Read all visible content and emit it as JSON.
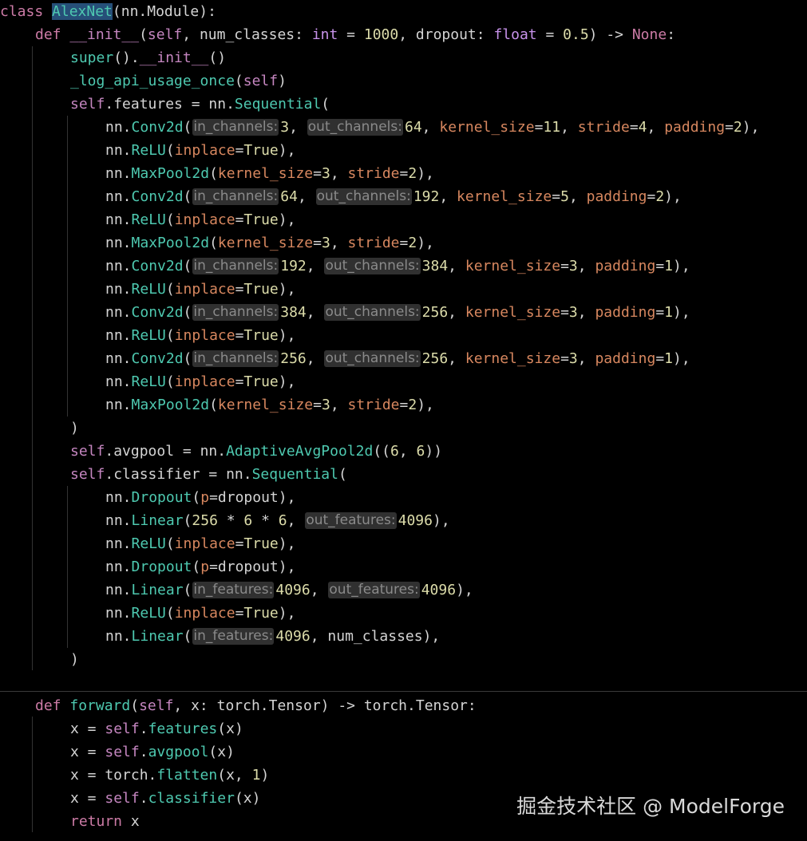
{
  "colors": {
    "background": "#000000",
    "default": "#d4d4d4",
    "keyword": "#cc7ba6",
    "function": "#4ec9b0",
    "self": "#c586c0",
    "number": "#dcdcaa",
    "param": "#d7875f",
    "dunder": "#c586c0",
    "class_name": "#4ec9b0",
    "type": "#c792ea",
    "hint_bg": "#303030",
    "hint_fg": "#8a8a8a",
    "watermark": "#d9d9d9"
  },
  "code_lines": [
    {
      "indent": 0,
      "tokens": [
        {
          "t": "class",
          "c": "keyword"
        },
        {
          "t": " "
        },
        {
          "t": "AlexNet",
          "c": "class_name",
          "cls": "cursor-hl"
        },
        {
          "t": "(nn.Module):"
        }
      ]
    },
    {
      "indent": 1,
      "tokens": [
        {
          "t": "def",
          "c": "keyword"
        },
        {
          "t": " "
        },
        {
          "t": "__init__",
          "c": "dunder"
        },
        {
          "t": "("
        },
        {
          "t": "self",
          "c": "self"
        },
        {
          "t": ", num_classes: "
        },
        {
          "t": "int",
          "c": "type"
        },
        {
          "t": " = "
        },
        {
          "t": "1000",
          "c": "number"
        },
        {
          "t": ", dropout: "
        },
        {
          "t": "float",
          "c": "type"
        },
        {
          "t": " = "
        },
        {
          "t": "0.5",
          "c": "number"
        },
        {
          "t": ") -> "
        },
        {
          "t": "None",
          "c": "keyword"
        },
        {
          "t": ":"
        }
      ]
    },
    {
      "indent": 2,
      "tokens": [
        {
          "t": "super",
          "c": "function"
        },
        {
          "t": "()."
        },
        {
          "t": "__init__",
          "c": "dunder"
        },
        {
          "t": "()"
        }
      ]
    },
    {
      "indent": 2,
      "tokens": [
        {
          "t": "_log_api_usage_once",
          "c": "function"
        },
        {
          "t": "("
        },
        {
          "t": "self",
          "c": "self"
        },
        {
          "t": ")"
        }
      ]
    },
    {
      "indent": 2,
      "tokens": [
        {
          "t": "self",
          "c": "self"
        },
        {
          "t": ".features = nn."
        },
        {
          "t": "Sequential",
          "c": "function"
        },
        {
          "t": "("
        }
      ]
    },
    {
      "indent": 3,
      "tokens": [
        {
          "t": "nn."
        },
        {
          "t": "Conv2d",
          "c": "function"
        },
        {
          "t": "("
        },
        {
          "hint": "in_channels:"
        },
        {
          "t": "3",
          "c": "number"
        },
        {
          "t": ", "
        },
        {
          "hint": "out_channels:"
        },
        {
          "t": "64",
          "c": "number"
        },
        {
          "t": ", "
        },
        {
          "t": "kernel_size",
          "c": "param"
        },
        {
          "t": "="
        },
        {
          "t": "11",
          "c": "number"
        },
        {
          "t": ", "
        },
        {
          "t": "stride",
          "c": "param"
        },
        {
          "t": "="
        },
        {
          "t": "4",
          "c": "number"
        },
        {
          "t": ", "
        },
        {
          "t": "padding",
          "c": "param"
        },
        {
          "t": "="
        },
        {
          "t": "2",
          "c": "number"
        },
        {
          "t": "),"
        }
      ]
    },
    {
      "indent": 3,
      "tokens": [
        {
          "t": "nn."
        },
        {
          "t": "ReLU",
          "c": "function"
        },
        {
          "t": "("
        },
        {
          "t": "inplace",
          "c": "param"
        },
        {
          "t": "="
        },
        {
          "t": "True",
          "c": "number"
        },
        {
          "t": "),"
        }
      ]
    },
    {
      "indent": 3,
      "tokens": [
        {
          "t": "nn."
        },
        {
          "t": "MaxPool2d",
          "c": "function"
        },
        {
          "t": "("
        },
        {
          "t": "kernel_size",
          "c": "param"
        },
        {
          "t": "="
        },
        {
          "t": "3",
          "c": "number"
        },
        {
          "t": ", "
        },
        {
          "t": "stride",
          "c": "param"
        },
        {
          "t": "="
        },
        {
          "t": "2",
          "c": "number"
        },
        {
          "t": "),"
        }
      ]
    },
    {
      "indent": 3,
      "tokens": [
        {
          "t": "nn."
        },
        {
          "t": "Conv2d",
          "c": "function"
        },
        {
          "t": "("
        },
        {
          "hint": "in_channels:"
        },
        {
          "t": "64",
          "c": "number"
        },
        {
          "t": ", "
        },
        {
          "hint": "out_channels:"
        },
        {
          "t": "192",
          "c": "number"
        },
        {
          "t": ", "
        },
        {
          "t": "kernel_size",
          "c": "param"
        },
        {
          "t": "="
        },
        {
          "t": "5",
          "c": "number"
        },
        {
          "t": ", "
        },
        {
          "t": "padding",
          "c": "param"
        },
        {
          "t": "="
        },
        {
          "t": "2",
          "c": "number"
        },
        {
          "t": "),"
        }
      ]
    },
    {
      "indent": 3,
      "tokens": [
        {
          "t": "nn."
        },
        {
          "t": "ReLU",
          "c": "function"
        },
        {
          "t": "("
        },
        {
          "t": "inplace",
          "c": "param"
        },
        {
          "t": "="
        },
        {
          "t": "True",
          "c": "number"
        },
        {
          "t": "),"
        }
      ]
    },
    {
      "indent": 3,
      "tokens": [
        {
          "t": "nn."
        },
        {
          "t": "MaxPool2d",
          "c": "function"
        },
        {
          "t": "("
        },
        {
          "t": "kernel_size",
          "c": "param"
        },
        {
          "t": "="
        },
        {
          "t": "3",
          "c": "number"
        },
        {
          "t": ", "
        },
        {
          "t": "stride",
          "c": "param"
        },
        {
          "t": "="
        },
        {
          "t": "2",
          "c": "number"
        },
        {
          "t": "),"
        }
      ]
    },
    {
      "indent": 3,
      "tokens": [
        {
          "t": "nn."
        },
        {
          "t": "Conv2d",
          "c": "function"
        },
        {
          "t": "("
        },
        {
          "hint": "in_channels:"
        },
        {
          "t": "192",
          "c": "number"
        },
        {
          "t": ", "
        },
        {
          "hint": "out_channels:"
        },
        {
          "t": "384",
          "c": "number"
        },
        {
          "t": ", "
        },
        {
          "t": "kernel_size",
          "c": "param"
        },
        {
          "t": "="
        },
        {
          "t": "3",
          "c": "number"
        },
        {
          "t": ", "
        },
        {
          "t": "padding",
          "c": "param"
        },
        {
          "t": "="
        },
        {
          "t": "1",
          "c": "number"
        },
        {
          "t": "),"
        }
      ]
    },
    {
      "indent": 3,
      "tokens": [
        {
          "t": "nn."
        },
        {
          "t": "ReLU",
          "c": "function"
        },
        {
          "t": "("
        },
        {
          "t": "inplace",
          "c": "param"
        },
        {
          "t": "="
        },
        {
          "t": "True",
          "c": "number"
        },
        {
          "t": "),"
        }
      ]
    },
    {
      "indent": 3,
      "tokens": [
        {
          "t": "nn."
        },
        {
          "t": "Conv2d",
          "c": "function"
        },
        {
          "t": "("
        },
        {
          "hint": "in_channels:"
        },
        {
          "t": "384",
          "c": "number"
        },
        {
          "t": ", "
        },
        {
          "hint": "out_channels:"
        },
        {
          "t": "256",
          "c": "number"
        },
        {
          "t": ", "
        },
        {
          "t": "kernel_size",
          "c": "param"
        },
        {
          "t": "="
        },
        {
          "t": "3",
          "c": "number"
        },
        {
          "t": ", "
        },
        {
          "t": "padding",
          "c": "param"
        },
        {
          "t": "="
        },
        {
          "t": "1",
          "c": "number"
        },
        {
          "t": "),"
        }
      ]
    },
    {
      "indent": 3,
      "tokens": [
        {
          "t": "nn."
        },
        {
          "t": "ReLU",
          "c": "function"
        },
        {
          "t": "("
        },
        {
          "t": "inplace",
          "c": "param"
        },
        {
          "t": "="
        },
        {
          "t": "True",
          "c": "number"
        },
        {
          "t": "),"
        }
      ]
    },
    {
      "indent": 3,
      "tokens": [
        {
          "t": "nn."
        },
        {
          "t": "Conv2d",
          "c": "function"
        },
        {
          "t": "("
        },
        {
          "hint": "in_channels:"
        },
        {
          "t": "256",
          "c": "number"
        },
        {
          "t": ", "
        },
        {
          "hint": "out_channels:"
        },
        {
          "t": "256",
          "c": "number"
        },
        {
          "t": ", "
        },
        {
          "t": "kernel_size",
          "c": "param"
        },
        {
          "t": "="
        },
        {
          "t": "3",
          "c": "number"
        },
        {
          "t": ", "
        },
        {
          "t": "padding",
          "c": "param"
        },
        {
          "t": "="
        },
        {
          "t": "1",
          "c": "number"
        },
        {
          "t": "),"
        }
      ]
    },
    {
      "indent": 3,
      "tokens": [
        {
          "t": "nn."
        },
        {
          "t": "ReLU",
          "c": "function"
        },
        {
          "t": "("
        },
        {
          "t": "inplace",
          "c": "param"
        },
        {
          "t": "="
        },
        {
          "t": "True",
          "c": "number"
        },
        {
          "t": "),"
        }
      ]
    },
    {
      "indent": 3,
      "tokens": [
        {
          "t": "nn."
        },
        {
          "t": "MaxPool2d",
          "c": "function"
        },
        {
          "t": "("
        },
        {
          "t": "kernel_size",
          "c": "param"
        },
        {
          "t": "="
        },
        {
          "t": "3",
          "c": "number"
        },
        {
          "t": ", "
        },
        {
          "t": "stride",
          "c": "param"
        },
        {
          "t": "="
        },
        {
          "t": "2",
          "c": "number"
        },
        {
          "t": "),"
        }
      ]
    },
    {
      "indent": 2,
      "tokens": [
        {
          "t": ")"
        }
      ]
    },
    {
      "indent": 2,
      "tokens": [
        {
          "t": "self",
          "c": "self"
        },
        {
          "t": ".avgpool = nn."
        },
        {
          "t": "AdaptiveAvgPool2d",
          "c": "function"
        },
        {
          "t": "(("
        },
        {
          "t": "6",
          "c": "number"
        },
        {
          "t": ", "
        },
        {
          "t": "6",
          "c": "number"
        },
        {
          "t": "))"
        }
      ]
    },
    {
      "indent": 2,
      "tokens": [
        {
          "t": "self",
          "c": "self"
        },
        {
          "t": ".classifier = nn."
        },
        {
          "t": "Sequential",
          "c": "function"
        },
        {
          "t": "("
        }
      ]
    },
    {
      "indent": 3,
      "tokens": [
        {
          "t": "nn."
        },
        {
          "t": "Dropout",
          "c": "function"
        },
        {
          "t": "("
        },
        {
          "t": "p",
          "c": "param"
        },
        {
          "t": "=dropout),"
        }
      ]
    },
    {
      "indent": 3,
      "tokens": [
        {
          "t": "nn."
        },
        {
          "t": "Linear",
          "c": "function"
        },
        {
          "t": "("
        },
        {
          "t": "256",
          "c": "number"
        },
        {
          "t": " * "
        },
        {
          "t": "6",
          "c": "number"
        },
        {
          "t": " * "
        },
        {
          "t": "6",
          "c": "number"
        },
        {
          "t": ", "
        },
        {
          "hint": "out_features:"
        },
        {
          "t": "4096",
          "c": "number"
        },
        {
          "t": "),"
        }
      ]
    },
    {
      "indent": 3,
      "tokens": [
        {
          "t": "nn."
        },
        {
          "t": "ReLU",
          "c": "function"
        },
        {
          "t": "("
        },
        {
          "t": "inplace",
          "c": "param"
        },
        {
          "t": "="
        },
        {
          "t": "True",
          "c": "number"
        },
        {
          "t": "),"
        }
      ]
    },
    {
      "indent": 3,
      "tokens": [
        {
          "t": "nn."
        },
        {
          "t": "Dropout",
          "c": "function"
        },
        {
          "t": "("
        },
        {
          "t": "p",
          "c": "param"
        },
        {
          "t": "=dropout),"
        }
      ]
    },
    {
      "indent": 3,
      "tokens": [
        {
          "t": "nn."
        },
        {
          "t": "Linear",
          "c": "function"
        },
        {
          "t": "("
        },
        {
          "hint": "in_features:"
        },
        {
          "t": "4096",
          "c": "number"
        },
        {
          "t": ", "
        },
        {
          "hint": "out_features:"
        },
        {
          "t": "4096",
          "c": "number"
        },
        {
          "t": "),"
        }
      ]
    },
    {
      "indent": 3,
      "tokens": [
        {
          "t": "nn."
        },
        {
          "t": "ReLU",
          "c": "function"
        },
        {
          "t": "("
        },
        {
          "t": "inplace",
          "c": "param"
        },
        {
          "t": "="
        },
        {
          "t": "True",
          "c": "number"
        },
        {
          "t": "),"
        }
      ]
    },
    {
      "indent": 3,
      "tokens": [
        {
          "t": "nn."
        },
        {
          "t": "Linear",
          "c": "function"
        },
        {
          "t": "("
        },
        {
          "hint": "in_features:"
        },
        {
          "t": "4096",
          "c": "number"
        },
        {
          "t": ", num_classes),"
        }
      ]
    },
    {
      "indent": 2,
      "tokens": [
        {
          "t": ")"
        }
      ]
    },
    {
      "indent": 0,
      "tokens": []
    },
    {
      "indent": 1,
      "tokens": [
        {
          "t": "def",
          "c": "keyword"
        },
        {
          "t": " "
        },
        {
          "t": "forward",
          "c": "function"
        },
        {
          "t": "("
        },
        {
          "t": "self",
          "c": "self"
        },
        {
          "t": ", x: torch.Tensor) -> torch.Tensor:"
        }
      ]
    },
    {
      "indent": 2,
      "tokens": [
        {
          "t": "x = "
        },
        {
          "t": "self",
          "c": "self"
        },
        {
          "t": "."
        },
        {
          "t": "features",
          "c": "function"
        },
        {
          "t": "(x)"
        }
      ]
    },
    {
      "indent": 2,
      "tokens": [
        {
          "t": "x = "
        },
        {
          "t": "self",
          "c": "self"
        },
        {
          "t": "."
        },
        {
          "t": "avgpool",
          "c": "function"
        },
        {
          "t": "(x)"
        }
      ]
    },
    {
      "indent": 2,
      "tokens": [
        {
          "t": "x = torch."
        },
        {
          "t": "flatten",
          "c": "function"
        },
        {
          "t": "(x, "
        },
        {
          "t": "1",
          "c": "number"
        },
        {
          "t": ")"
        }
      ]
    },
    {
      "indent": 2,
      "tokens": [
        {
          "t": "x = "
        },
        {
          "t": "self",
          "c": "self"
        },
        {
          "t": "."
        },
        {
          "t": "classifier",
          "c": "function"
        },
        {
          "t": "(x)"
        }
      ]
    },
    {
      "indent": 2,
      "tokens": [
        {
          "t": "return",
          "c": "keyword"
        },
        {
          "t": " x"
        }
      ]
    }
  ],
  "watermark": "掘金技术社区 @ ModelForge"
}
